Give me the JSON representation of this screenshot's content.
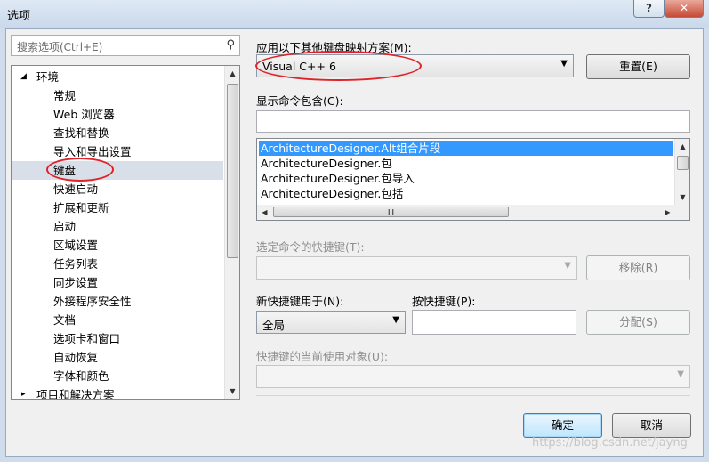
{
  "window": {
    "title": "选项",
    "help_symbol": "?",
    "close_symbol": "✕"
  },
  "search": {
    "placeholder": "搜索选项(Ctrl+E)",
    "icon": "search-icon"
  },
  "tree": {
    "root_label": "环境",
    "root_expander": "◢",
    "items": [
      "常规",
      "Web 浏览器",
      "查找和替换",
      "导入和导出设置",
      "键盘",
      "快速启动",
      "扩展和更新",
      "启动",
      "区域设置",
      "任务列表",
      "同步设置",
      "外接程序安全性",
      "文档",
      "选项卡和窗口",
      "自动恢复",
      "字体和颜色"
    ],
    "selected": "键盘",
    "next_root_label": "项目和解决方案",
    "next_root_expander": "▸"
  },
  "mapping": {
    "label": "应用以下其他键盘映射方案(M):",
    "value": "Visual C++ 6",
    "reset_label": "重置(E)"
  },
  "show_commands": {
    "label": "显示命令包含(C):",
    "value": ""
  },
  "command_list": {
    "items": [
      "ArchitectureDesigner.Alt组合片段",
      "ArchitectureDesigner.包",
      "ArchitectureDesigner.包导入",
      "ArchitectureDesigner.包括"
    ],
    "selected_index": 0,
    "hscroll_grip": "III"
  },
  "shortcuts": {
    "label": "选定命令的快捷键(T):",
    "value": "",
    "remove_label": "移除(R)"
  },
  "new_shortcut": {
    "label": "新快捷键用于(N):",
    "value": "全局"
  },
  "press_keys": {
    "label": "按快捷键(P):",
    "value": "",
    "assign_label": "分配(S)"
  },
  "used_by": {
    "label": "快捷键的当前使用对象(U):",
    "value": ""
  },
  "footer": {
    "ok_label": "确定",
    "cancel_label": "取消"
  },
  "watermark": "https://blog.csdn.net/jayng",
  "colors": {
    "selection": "#3399ff",
    "annotation": "#e0222a"
  }
}
